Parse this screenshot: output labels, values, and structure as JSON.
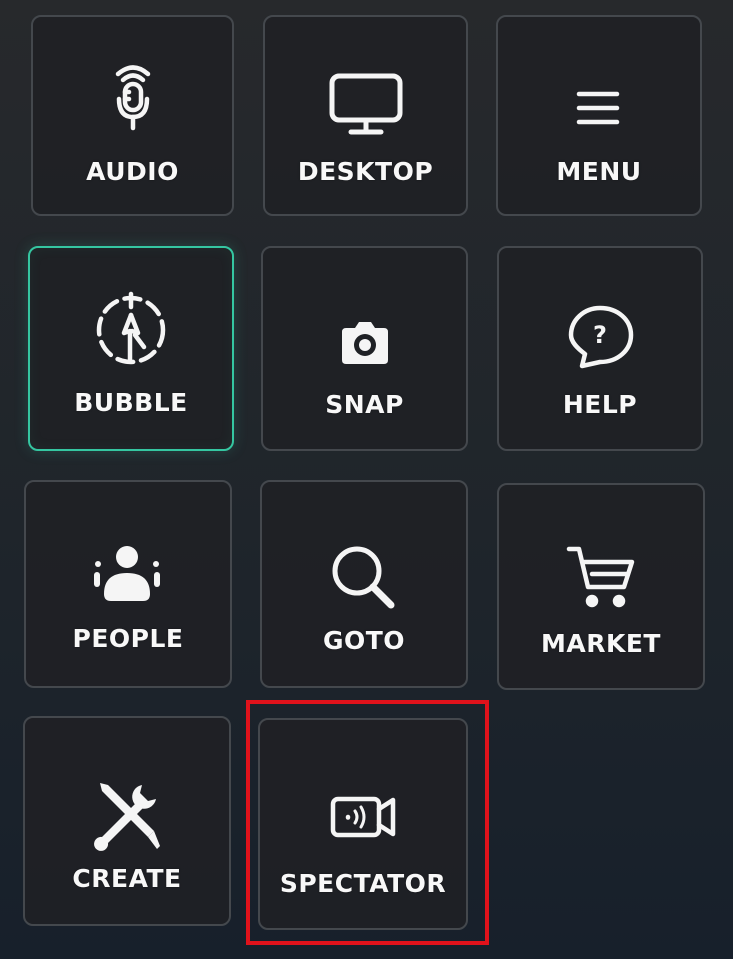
{
  "menu": {
    "tiles": [
      {
        "label": "AUDIO",
        "icon": "microphone-icon"
      },
      {
        "label": "DESKTOP",
        "icon": "monitor-icon"
      },
      {
        "label": "MENU",
        "icon": "hamburger-menu-icon"
      },
      {
        "label": "BUBBLE",
        "icon": "bubble-icon",
        "active": true
      },
      {
        "label": "SNAP",
        "icon": "camera-icon"
      },
      {
        "label": "HELP",
        "icon": "help-icon"
      },
      {
        "label": "PEOPLE",
        "icon": "people-icon"
      },
      {
        "label": "GOTO",
        "icon": "search-icon"
      },
      {
        "label": "MARKET",
        "icon": "cart-icon"
      },
      {
        "label": "CREATE",
        "icon": "create-tools-icon"
      },
      {
        "label": "SPECTATOR",
        "icon": "spectator-camera-icon",
        "highlighted": true
      }
    ]
  },
  "colors": {
    "active_border": "#35c6a1",
    "highlight_frame": "#e0121b",
    "tile_border": "#44484d",
    "text": "#f8f8f8"
  }
}
